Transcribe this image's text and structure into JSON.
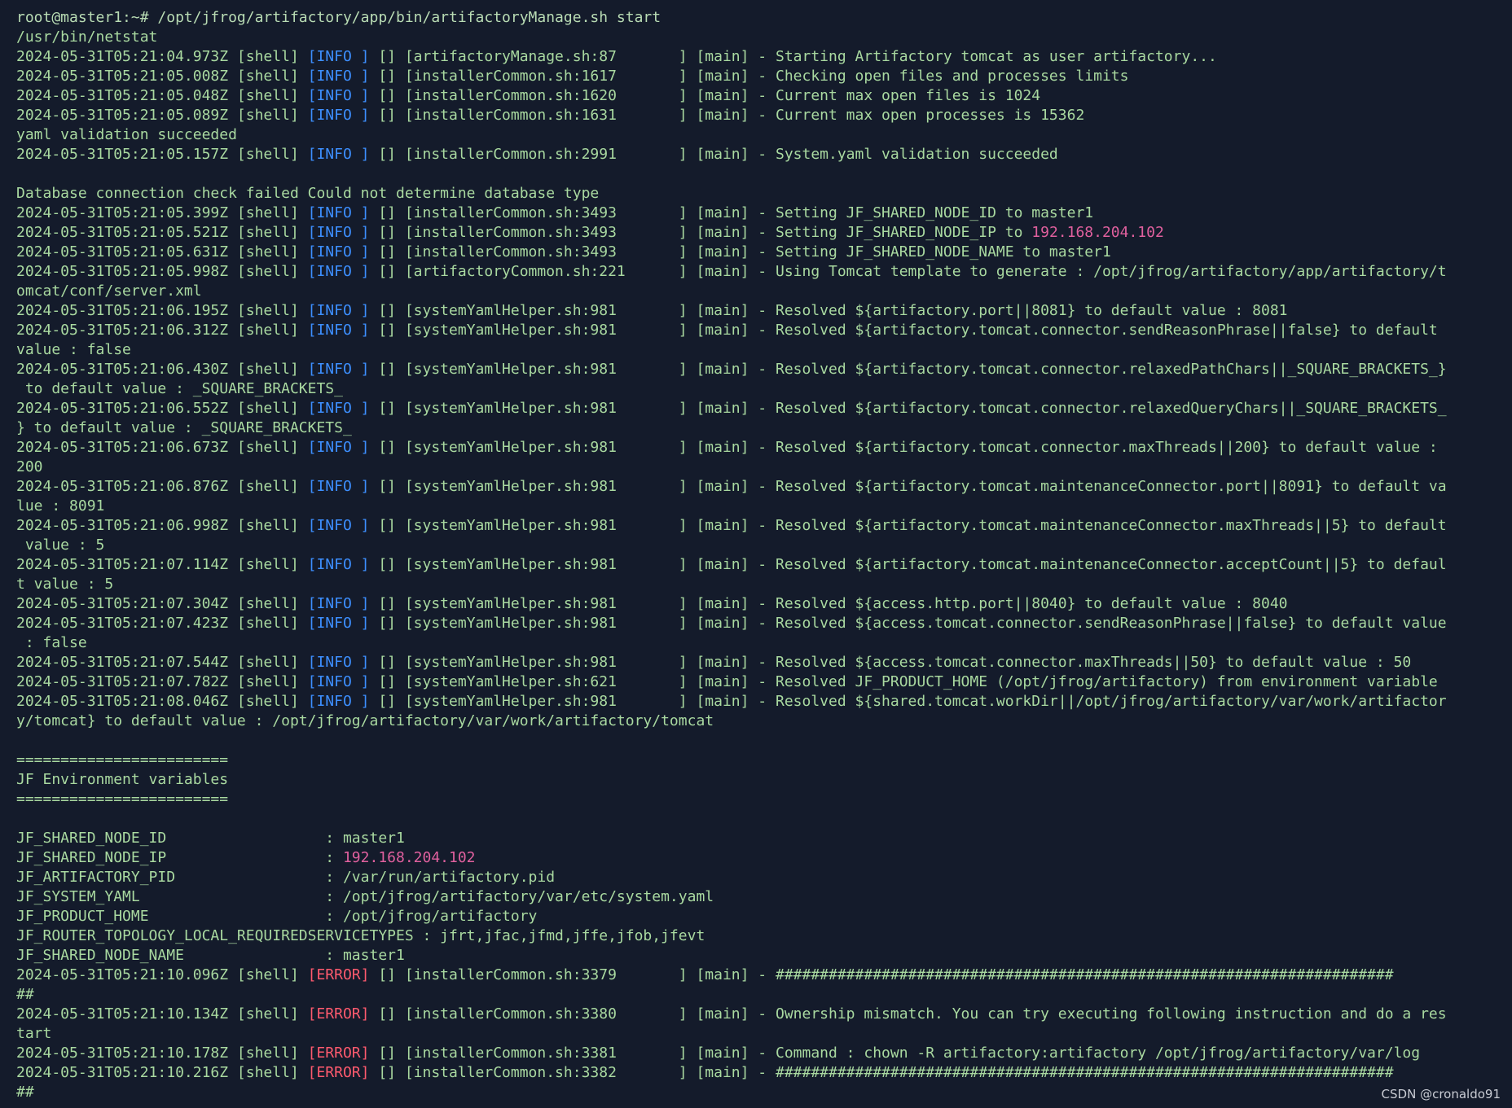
{
  "terminal": {
    "colors": {
      "background": "#141b2b",
      "text": "#a9d9a0",
      "info": "#3d8fff",
      "error": "#ff5a6e",
      "ip": "#e0609e"
    },
    "lines": [
      [
        {
          "t": "root@master1:~# /opt/jfrog/artifactory/app/bin/artifactoryManage.sh start",
          "c": "prompt"
        }
      ],
      [
        {
          "t": "/usr/bin/netstat"
        }
      ],
      [
        {
          "t": "2024-05-31T05:21:04.973Z [shell] "
        },
        {
          "t": "[INFO ]",
          "c": "info"
        },
        {
          "t": " [] [artifactoryManage.sh:87       ] [main] - Starting Artifactory tomcat as user artifactory..."
        }
      ],
      [
        {
          "t": "2024-05-31T05:21:05.008Z [shell] "
        },
        {
          "t": "[INFO ]",
          "c": "info"
        },
        {
          "t": " [] [installerCommon.sh:1617       ] [main] - Checking open files and processes limits"
        }
      ],
      [
        {
          "t": "2024-05-31T05:21:05.048Z [shell] "
        },
        {
          "t": "[INFO ]",
          "c": "info"
        },
        {
          "t": " [] [installerCommon.sh:1620       ] [main] - Current max open files is 1024"
        }
      ],
      [
        {
          "t": "2024-05-31T05:21:05.089Z [shell] "
        },
        {
          "t": "[INFO ]",
          "c": "info"
        },
        {
          "t": " [] [installerCommon.sh:1631       ] [main] - Current max open processes is 15362"
        }
      ],
      [
        {
          "t": "yaml validation succeeded"
        }
      ],
      [
        {
          "t": "2024-05-31T05:21:05.157Z [shell] "
        },
        {
          "t": "[INFO ]",
          "c": "info"
        },
        {
          "t": " [] [installerCommon.sh:2991       ] [main] - System.yaml validation succeeded"
        }
      ],
      [],
      [
        {
          "t": "Database connection check failed Could not determine database type"
        }
      ],
      [
        {
          "t": "2024-05-31T05:21:05.399Z [shell] "
        },
        {
          "t": "[INFO ]",
          "c": "info"
        },
        {
          "t": " [] [installerCommon.sh:3493       ] [main] - Setting JF_SHARED_NODE_ID to master1"
        }
      ],
      [
        {
          "t": "2024-05-31T05:21:05.521Z [shell] "
        },
        {
          "t": "[INFO ]",
          "c": "info"
        },
        {
          "t": " [] [installerCommon.sh:3493       ] [main] - Setting JF_SHARED_NODE_IP to "
        },
        {
          "t": "192.168.204.102",
          "c": "ip"
        }
      ],
      [
        {
          "t": "2024-05-31T05:21:05.631Z [shell] "
        },
        {
          "t": "[INFO ]",
          "c": "info"
        },
        {
          "t": " [] [installerCommon.sh:3493       ] [main] - Setting JF_SHARED_NODE_NAME to master1"
        }
      ],
      [
        {
          "t": "2024-05-31T05:21:05.998Z [shell] "
        },
        {
          "t": "[INFO ]",
          "c": "info"
        },
        {
          "t": " [] [artifactoryCommon.sh:221      ] [main] - Using Tomcat template to generate : /opt/jfrog/artifactory/app/artifactory/t"
        }
      ],
      [
        {
          "t": "omcat/conf/server.xml"
        }
      ],
      [
        {
          "t": "2024-05-31T05:21:06.195Z [shell] "
        },
        {
          "t": "[INFO ]",
          "c": "info"
        },
        {
          "t": " [] [systemYamlHelper.sh:981       ] [main] - Resolved ${artifactory.port||8081} to default value : 8081"
        }
      ],
      [
        {
          "t": "2024-05-31T05:21:06.312Z [shell] "
        },
        {
          "t": "[INFO ]",
          "c": "info"
        },
        {
          "t": " [] [systemYamlHelper.sh:981       ] [main] - Resolved ${artifactory.tomcat.connector.sendReasonPhrase||false} to default"
        }
      ],
      [
        {
          "t": "value : false"
        }
      ],
      [
        {
          "t": "2024-05-31T05:21:06.430Z [shell] "
        },
        {
          "t": "[INFO ]",
          "c": "info"
        },
        {
          "t": " [] [systemYamlHelper.sh:981       ] [main] - Resolved ${artifactory.tomcat.connector.relaxedPathChars||_SQUARE_BRACKETS_}"
        }
      ],
      [
        {
          "t": " to default value : _SQUARE_BRACKETS_"
        }
      ],
      [
        {
          "t": "2024-05-31T05:21:06.552Z [shell] "
        },
        {
          "t": "[INFO ]",
          "c": "info"
        },
        {
          "t": " [] [systemYamlHelper.sh:981       ] [main] - Resolved ${artifactory.tomcat.connector.relaxedQueryChars||_SQUARE_BRACKETS_"
        }
      ],
      [
        {
          "t": "} to default value : _SQUARE_BRACKETS_"
        }
      ],
      [
        {
          "t": "2024-05-31T05:21:06.673Z [shell] "
        },
        {
          "t": "[INFO ]",
          "c": "info"
        },
        {
          "t": " [] [systemYamlHelper.sh:981       ] [main] - Resolved ${artifactory.tomcat.connector.maxThreads||200} to default value :"
        }
      ],
      [
        {
          "t": "200"
        }
      ],
      [
        {
          "t": "2024-05-31T05:21:06.876Z [shell] "
        },
        {
          "t": "[INFO ]",
          "c": "info"
        },
        {
          "t": " [] [systemYamlHelper.sh:981       ] [main] - Resolved ${artifactory.tomcat.maintenanceConnector.port||8091} to default va"
        }
      ],
      [
        {
          "t": "lue : 8091"
        }
      ],
      [
        {
          "t": "2024-05-31T05:21:06.998Z [shell] "
        },
        {
          "t": "[INFO ]",
          "c": "info"
        },
        {
          "t": " [] [systemYamlHelper.sh:981       ] [main] - Resolved ${artifactory.tomcat.maintenanceConnector.maxThreads||5} to default"
        }
      ],
      [
        {
          "t": " value : 5"
        }
      ],
      [
        {
          "t": "2024-05-31T05:21:07.114Z [shell] "
        },
        {
          "t": "[INFO ]",
          "c": "info"
        },
        {
          "t": " [] [systemYamlHelper.sh:981       ] [main] - Resolved ${artifactory.tomcat.maintenanceConnector.acceptCount||5} to defaul"
        }
      ],
      [
        {
          "t": "t value : 5"
        }
      ],
      [
        {
          "t": "2024-05-31T05:21:07.304Z [shell] "
        },
        {
          "t": "[INFO ]",
          "c": "info"
        },
        {
          "t": " [] [systemYamlHelper.sh:981       ] [main] - Resolved ${access.http.port||8040} to default value : 8040"
        }
      ],
      [
        {
          "t": "2024-05-31T05:21:07.423Z [shell] "
        },
        {
          "t": "[INFO ]",
          "c": "info"
        },
        {
          "t": " [] [systemYamlHelper.sh:981       ] [main] - Resolved ${access.tomcat.connector.sendReasonPhrase||false} to default value"
        }
      ],
      [
        {
          "t": " : false"
        }
      ],
      [
        {
          "t": "2024-05-31T05:21:07.544Z [shell] "
        },
        {
          "t": "[INFO ]",
          "c": "info"
        },
        {
          "t": " [] [systemYamlHelper.sh:981       ] [main] - Resolved ${access.tomcat.connector.maxThreads||50} to default value : 50"
        }
      ],
      [
        {
          "t": "2024-05-31T05:21:07.782Z [shell] "
        },
        {
          "t": "[INFO ]",
          "c": "info"
        },
        {
          "t": " [] [systemYamlHelper.sh:621       ] [main] - Resolved JF_PRODUCT_HOME (/opt/jfrog/artifactory) from environment variable"
        }
      ],
      [
        {
          "t": "2024-05-31T05:21:08.046Z [shell] "
        },
        {
          "t": "[INFO ]",
          "c": "info"
        },
        {
          "t": " [] [systemYamlHelper.sh:981       ] [main] - Resolved ${shared.tomcat.workDir||/opt/jfrog/artifactory/var/work/artifactor"
        }
      ],
      [
        {
          "t": "y/tomcat} to default value : /opt/jfrog/artifactory/var/work/artifactory/tomcat"
        }
      ],
      [],
      [
        {
          "t": "========================"
        }
      ],
      [
        {
          "t": "JF Environment variables"
        }
      ],
      [
        {
          "t": "========================"
        }
      ],
      [],
      [
        {
          "t": "JF_SHARED_NODE_ID                  : master1"
        }
      ],
      [
        {
          "t": "JF_SHARED_NODE_IP                  : "
        },
        {
          "t": "192.168.204.102",
          "c": "ip"
        }
      ],
      [
        {
          "t": "JF_ARTIFACTORY_PID                 : /var/run/artifactory.pid"
        }
      ],
      [
        {
          "t": "JF_SYSTEM_YAML                     : /opt/jfrog/artifactory/var/etc/system.yaml"
        }
      ],
      [
        {
          "t": "JF_PRODUCT_HOME                    : /opt/jfrog/artifactory"
        }
      ],
      [
        {
          "t": "JF_ROUTER_TOPOLOGY_LOCAL_REQUIREDSERVICETYPES : jfrt,jfac,jfmd,jffe,jfob,jfevt"
        }
      ],
      [
        {
          "t": "JF_SHARED_NODE_NAME                : master1"
        }
      ],
      [
        {
          "t": "2024-05-31T05:21:10.096Z [shell] "
        },
        {
          "t": "[ERROR]",
          "c": "error"
        },
        {
          "t": " [] [installerCommon.sh:3379       ] [main] - ######################################################################"
        }
      ],
      [
        {
          "t": "##"
        }
      ],
      [
        {
          "t": "2024-05-31T05:21:10.134Z [shell] "
        },
        {
          "t": "[ERROR]",
          "c": "error"
        },
        {
          "t": " [] [installerCommon.sh:3380       ] [main] - Ownership mismatch. You can try executing following instruction and do a res"
        }
      ],
      [
        {
          "t": "tart"
        }
      ],
      [
        {
          "t": "2024-05-31T05:21:10.178Z [shell] "
        },
        {
          "t": "[ERROR]",
          "c": "error"
        },
        {
          "t": " [] [installerCommon.sh:3381       ] [main] - Command : chown -R artifactory:artifactory /opt/jfrog/artifactory/var/log"
        }
      ],
      [
        {
          "t": "2024-05-31T05:21:10.216Z [shell] "
        },
        {
          "t": "[ERROR]",
          "c": "error"
        },
        {
          "t": " [] [installerCommon.sh:3382       ] [main] - ######################################################################"
        }
      ],
      [
        {
          "t": "##"
        }
      ]
    ]
  },
  "watermark": "CSDN @cronaldo91"
}
